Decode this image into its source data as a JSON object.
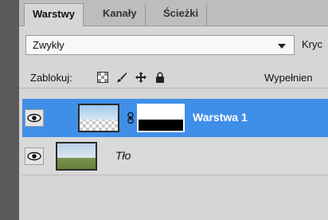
{
  "tabs": [
    {
      "label": "Warstwy",
      "active": true
    },
    {
      "label": "Kanały",
      "active": false
    },
    {
      "label": "Ścieżki",
      "active": false
    }
  ],
  "blend": {
    "value": "Zwykły",
    "opacity_label": "Kryc"
  },
  "lock": {
    "label": "Zablokuj:",
    "fill_label": "Wypełnien"
  },
  "layers": [
    {
      "name": "Warstwa 1",
      "selected": true,
      "visible": true,
      "has_mask": true
    },
    {
      "name": "Tło",
      "selected": false,
      "visible": true,
      "has_mask": false
    }
  ],
  "colors": {
    "selected": "#3f8fe8",
    "panel": "#d6d6d6",
    "strip": "#5a5a5a"
  },
  "icons": [
    "eye-icon",
    "chain-link-icon",
    "lock-transparent-pixels-icon",
    "lock-image-pixels-icon",
    "lock-position-icon",
    "lock-all-icon",
    "dropdown-arrow-icon"
  ]
}
